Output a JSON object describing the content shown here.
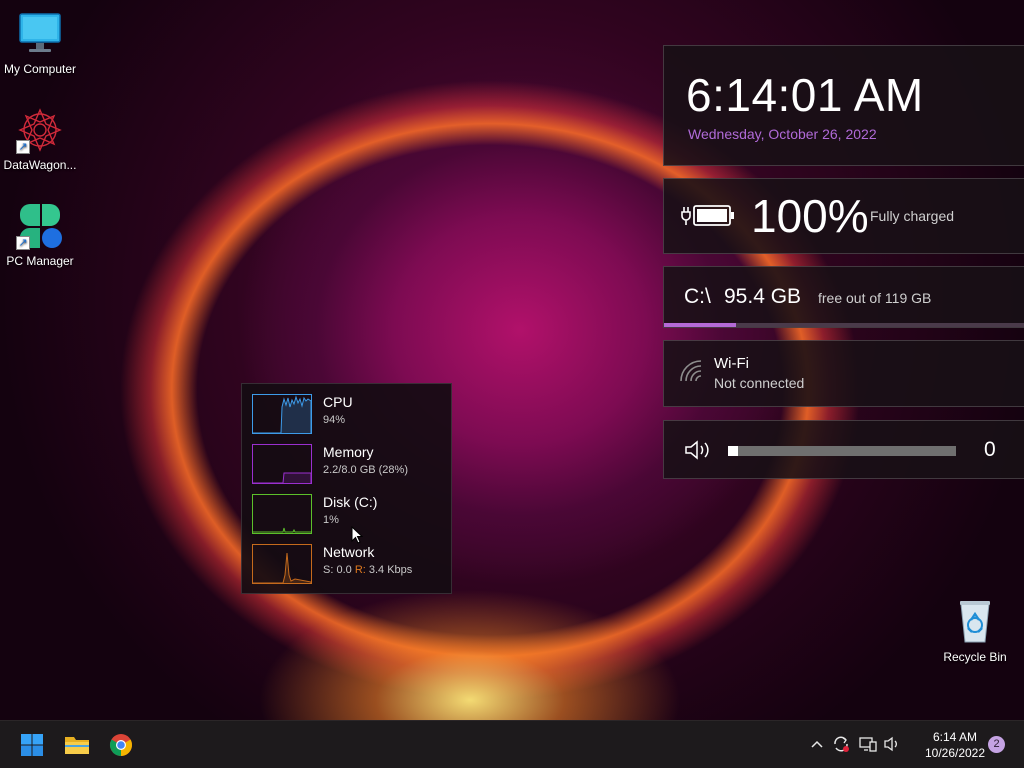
{
  "desktop": {
    "icons": [
      {
        "label": "My Computer"
      },
      {
        "label": "DataWagon..."
      },
      {
        "label": "PC Manager"
      },
      {
        "label": "Recycle Bin"
      }
    ]
  },
  "widgets": {
    "clock": {
      "time": "6:14:01 AM",
      "date": "Wednesday, October 26, 2022"
    },
    "battery": {
      "percent": "100%",
      "status": "Fully charged"
    },
    "disk": {
      "drive": "C:\\",
      "free": "95.4 GB",
      "label": "free out of 119 GB",
      "used_fraction": 0.2
    },
    "wifi": {
      "name": "Wi-Fi",
      "status": "Not connected"
    },
    "volume": {
      "value": "0",
      "level_fraction": 0.0
    }
  },
  "perf_popup": {
    "cpu": {
      "title": "CPU",
      "value": "94%",
      "color": "#3d9be9"
    },
    "memory": {
      "title": "Memory",
      "value": "2.2/8.0 GB (28%)",
      "color": "#9a2fcf"
    },
    "disk": {
      "title": "Disk (C:)",
      "value": "1%",
      "color": "#5cbf2a"
    },
    "network": {
      "title": "Network",
      "send_label": "S: 0.0",
      "recv_key": "R:",
      "recv_value": "3.4 Kbps",
      "color": "#c56a1c"
    }
  },
  "taskbar": {
    "apps": [
      "start-icon",
      "file-explorer-icon",
      "chrome-icon"
    ],
    "tray": {
      "time": "6:14 AM",
      "date": "10/26/2022",
      "notifications": "2"
    }
  }
}
